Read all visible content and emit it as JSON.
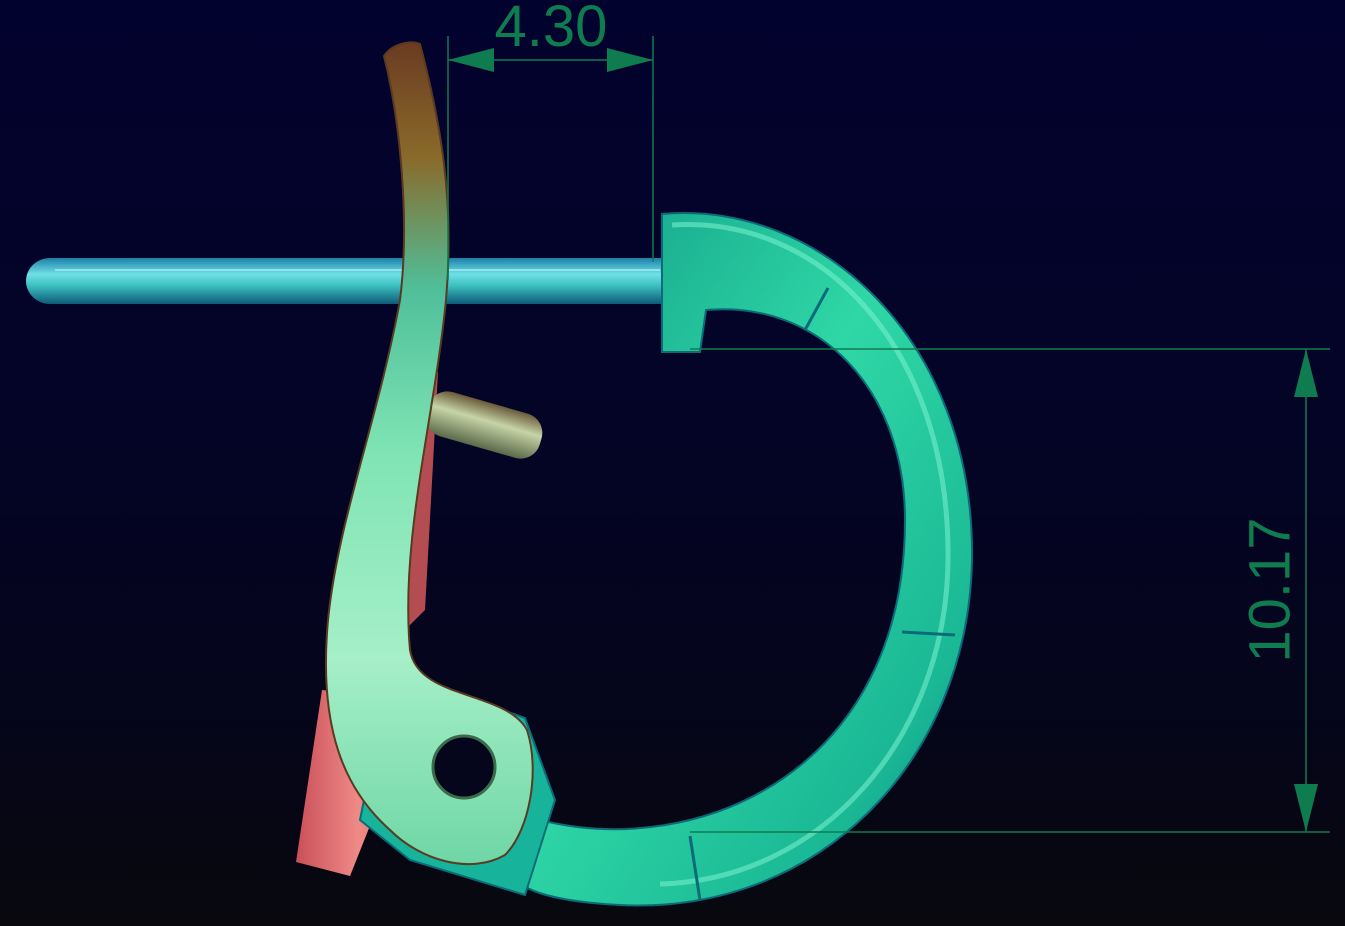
{
  "dimensions": {
    "width_label": "4.30",
    "height_label": "10.17"
  },
  "colors": {
    "background_top": "#02022e",
    "background_bottom": "#08080e",
    "dimension_line": "#0e7c4f",
    "hoop": "#1fc79a",
    "post": "#2ab5b0",
    "lever_gold": "#8a6a2a",
    "lever_mint": "#8fe8c0",
    "pin": "#8a9a6a",
    "flat_pink": "#e87b7b"
  }
}
